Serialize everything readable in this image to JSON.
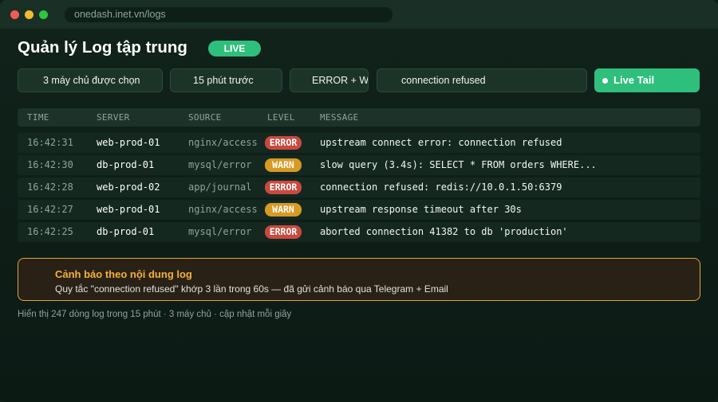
{
  "browser": {
    "url": "onedash.inet.vn/logs"
  },
  "header": {
    "title": "Quản lý Log tập trung",
    "live_badge": "LIVE"
  },
  "filters": {
    "hosts": "3 máy chủ được chọn",
    "time_range": "15 phút trước",
    "level": "ERROR + WARN",
    "search_value": "connection refused",
    "live_tail_label": "Live Tail"
  },
  "table": {
    "columns": [
      "TIME",
      "SERVER",
      "SOURCE",
      "LEVEL",
      "MESSAGE"
    ],
    "rows": [
      {
        "time": "16:42:31",
        "server": "web-prod-01",
        "source": "nginx/access",
        "level": "ERROR",
        "message": "upstream connect error: connection refused"
      },
      {
        "time": "16:42:30",
        "server": "db-prod-01",
        "source": "mysql/error",
        "level": "WARN",
        "message": "slow query (3.4s): SELECT * FROM orders WHERE..."
      },
      {
        "time": "16:42:28",
        "server": "web-prod-02",
        "source": "app/journal",
        "level": "ERROR",
        "message": "connection refused: redis://10.0.1.50:6379"
      },
      {
        "time": "16:42:27",
        "server": "web-prod-01",
        "source": "nginx/access",
        "level": "WARN",
        "message": "upstream response timeout after 30s"
      },
      {
        "time": "16:42:25",
        "server": "db-prod-01",
        "source": "mysql/error",
        "level": "ERROR",
        "message": "aborted connection 41382 to db 'production'"
      }
    ]
  },
  "alert": {
    "title": "Cảnh báo theo nội dung log",
    "body": "Quy tắc \"connection refused\" khớp 3 lần trong 60s — đã gửi cảnh báo qua Telegram + Email"
  },
  "footer": {
    "status": "Hiển thị 247 dòng log trong 15 phút · 3 máy chủ · cập nhật mỗi giây"
  },
  "colors": {
    "accent": "#2fbf7c",
    "error": "#c84a3e",
    "warn": "#d79a22",
    "alert_border": "#e0a63a"
  }
}
